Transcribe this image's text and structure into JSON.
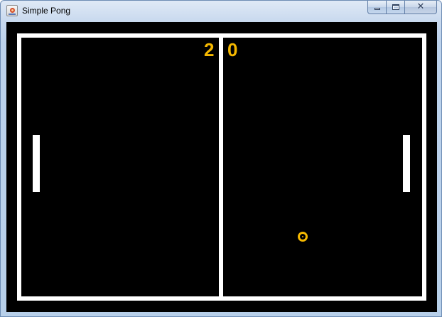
{
  "window": {
    "title": "Simple Pong",
    "icon": "java-app-icon",
    "controls": {
      "minimize_icon": "minimize-icon",
      "maximize_icon": "maximize-icon",
      "close_icon": "close-icon",
      "close_glyph": "✕"
    }
  },
  "game": {
    "background_color": "#000000",
    "court_color": "#ffffff",
    "accent_color": "#f5b800",
    "score": {
      "left": "2",
      "right": "0"
    }
  }
}
